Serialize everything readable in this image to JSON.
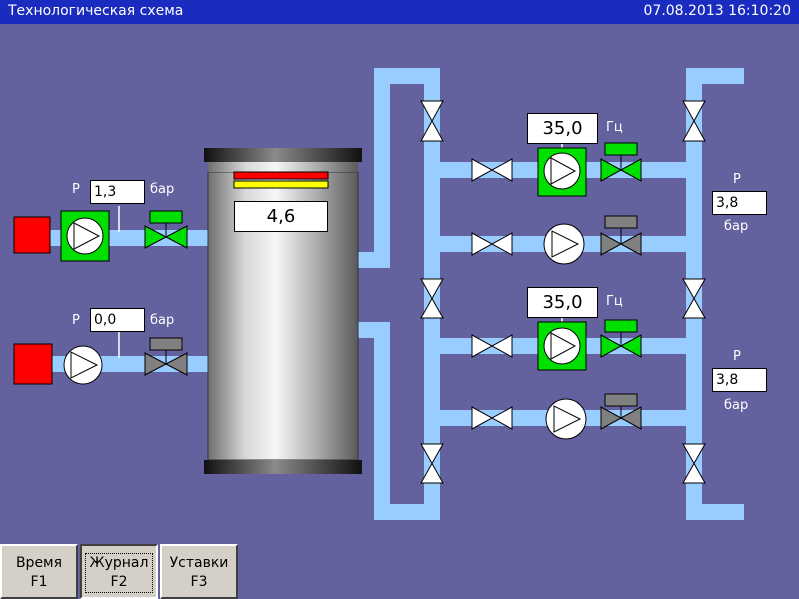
{
  "header": {
    "title": "Технологическая схема",
    "datetime": "07.08.2013 16:10:20"
  },
  "tank": {
    "level_value": "4,6"
  },
  "inlet_line_1": {
    "pressure_label": "P",
    "pressure_value": "1,3",
    "pressure_unit": "бар",
    "pump_state": "running",
    "valve_state": "open"
  },
  "inlet_line_2": {
    "pressure_label": "P",
    "pressure_value": "0,0",
    "pressure_unit": "бар",
    "pump_state": "stopped",
    "valve_state": "closed"
  },
  "pump_group_1": {
    "pump_a": {
      "frequency_value": "35,0",
      "frequency_unit": "Гц",
      "state": "running",
      "valve_state": "open"
    },
    "pump_b": {
      "state": "stopped",
      "valve_state": "closed"
    },
    "outlet": {
      "pressure_label": "P",
      "pressure_value": "3,8",
      "pressure_unit": "бар"
    }
  },
  "pump_group_2": {
    "pump_a": {
      "frequency_value": "35,0",
      "frequency_unit": "Гц",
      "state": "running",
      "valve_state": "open"
    },
    "pump_b": {
      "state": "stopped",
      "valve_state": "closed"
    },
    "outlet": {
      "pressure_label": "P",
      "pressure_value": "3,8",
      "pressure_unit": "бар"
    }
  },
  "function_keys": [
    {
      "label": "Время",
      "key": "F1"
    },
    {
      "label": "Журнал",
      "key": "F2",
      "pressed": true
    },
    {
      "label": "Уставки",
      "key": "F3"
    }
  ],
  "colors": {
    "background": "#63619e",
    "pipe": "#99ccff",
    "running": "#00e000",
    "stopped_valve": "#808080",
    "alarm": "#ff0000",
    "title_bar": "#1a2bc0"
  }
}
